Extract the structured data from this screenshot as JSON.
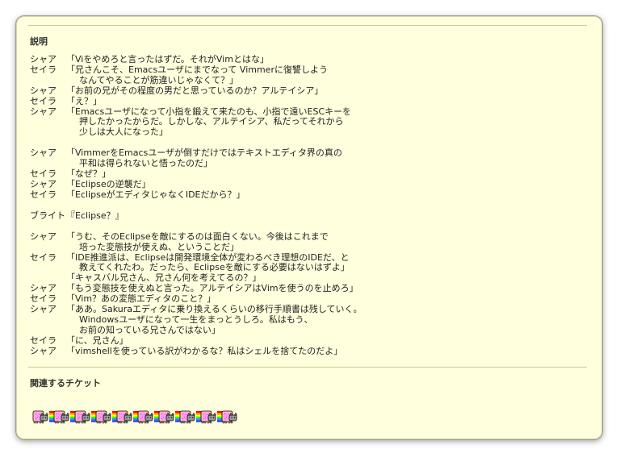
{
  "description": {
    "title": "説明",
    "dialogue": [
      {
        "speaker": "シャア",
        "lines": [
          "「Viをやめろと言ったはずだ。それがVimとはな」"
        ]
      },
      {
        "speaker": "セイラ",
        "lines": [
          "「兄さんこそ、Emacsユーザにまでなって Vimmerに復讐しよう",
          "なんてやることが筋違いじゃなくて？」"
        ]
      },
      {
        "speaker": "シャア",
        "lines": [
          "「お前の兄がその程度の男だと思っているのか？アルテイシア」"
        ]
      },
      {
        "speaker": "セイラ",
        "lines": [
          "「え？」"
        ]
      },
      {
        "speaker": "シャア",
        "lines": [
          "「Emacsユーザになって小指を鍛えて来たのも、小指で遠いESCキーを",
          "押したかったからだ。しかしな、アルテイシア、私だってそれから",
          "少しは大人になった」"
        ]
      },
      {
        "gap": true
      },
      {
        "speaker": "シャア",
        "lines": [
          "「VimmerをEmacsユーザが倒すだけではテキストエディタ界の真の",
          "平和は得られないと悟ったのだ」"
        ]
      },
      {
        "speaker": "セイラ",
        "lines": [
          "「なぜ？」"
        ]
      },
      {
        "speaker": "シャア",
        "lines": [
          "「Eclipseの逆襲だ」"
        ]
      },
      {
        "speaker": "セイラ",
        "lines": [
          "「EclipseがエディタじゃなくIDEだから？」"
        ]
      },
      {
        "gap": true
      },
      {
        "speaker": "ブライト",
        "lines": [
          "『Eclipse？』"
        ]
      },
      {
        "gap": true
      },
      {
        "speaker": "シャア",
        "lines": [
          "「うむ、そのEclipseを敵にするのは面白くない。今後はこれまで",
          "培った変態技が使えぬ、ということだ」"
        ]
      },
      {
        "speaker": "セイラ",
        "lines": [
          "「IDE推進派は、Eclipseは開発環境全体が変わるべき理想のIDEだ、と",
          "教えてくれたわ。だったら、Eclipseを敵にする必要はないはずよ」"
        ]
      },
      {
        "speaker": "",
        "lines": [
          "「キャスバル兄さん、兄さん何を考えてるの？」"
        ]
      },
      {
        "speaker": "シャア",
        "lines": [
          "「もう変態技を使えぬと言った。アルテイシアはVimを使うのを止めろ」"
        ]
      },
      {
        "speaker": "セイラ",
        "lines": [
          "「Vim？あの変態エディタのこと？」"
        ]
      },
      {
        "speaker": "シャア",
        "lines": [
          "「ああ。Sakuraエディタに乗り換えるくらいの移行手順書は残していく。",
          "Windowsユーザになって一生をまっとうしろ。私はもう、",
          "お前の知っている兄さんではない」"
        ]
      },
      {
        "speaker": "セイラ",
        "lines": [
          "「に、兄さん」"
        ]
      },
      {
        "speaker": "シャア",
        "lines": [
          "「vimshellを使っている訳がわかるな？私はシェルを捨てたのだよ」"
        ]
      }
    ]
  },
  "related": {
    "title": "関連するチケット",
    "tickets": [
      {
        "icon": "nyan-cat-icon"
      },
      {
        "icon": "nyan-cat-icon"
      },
      {
        "icon": "nyan-cat-icon"
      },
      {
        "icon": "nyan-cat-icon"
      },
      {
        "icon": "nyan-cat-icon"
      },
      {
        "icon": "nyan-cat-icon"
      },
      {
        "icon": "nyan-cat-icon"
      },
      {
        "icon": "nyan-cat-icon"
      },
      {
        "icon": "nyan-cat-icon"
      },
      {
        "icon": "nyan-cat-icon"
      }
    ]
  },
  "colors": {
    "panel_background": "#ffffdd",
    "rainbow": [
      "#ff0000",
      "#ff9900",
      "#ffff00",
      "#33ff00",
      "#0099ff",
      "#6633ff"
    ],
    "poptart_body": "#ff99ff",
    "cat_gray": "#999999"
  }
}
